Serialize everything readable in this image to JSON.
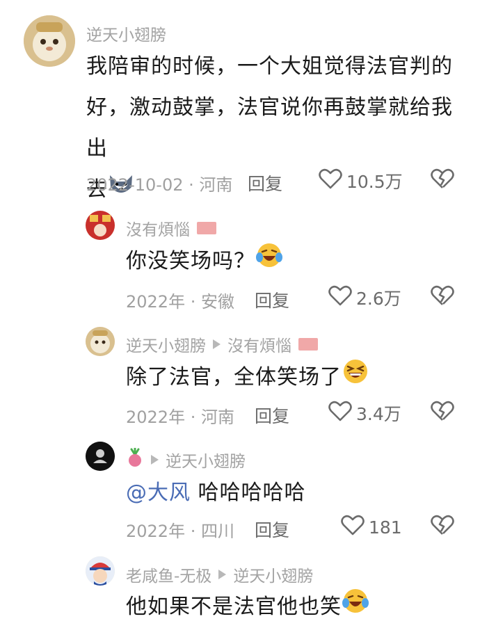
{
  "comments": [
    {
      "user": "逆天小翅膀",
      "text1": "我陪审的时候，一个大姐觉得法官判的",
      "text2": "好，激动鼓掌，法官说你再鼓掌就给我出",
      "text3": "去",
      "date": "2022-10-02",
      "location": "河南",
      "reply": "回复",
      "likes": "10.5万"
    },
    {
      "user": "沒有煩惱",
      "text": "你没笑场吗？",
      "date": "2022年",
      "location": "安徽",
      "reply": "回复",
      "likes": "2.6万"
    },
    {
      "user": "逆天小翅膀",
      "reply_to": "沒有煩惱",
      "text": "除了法官，全体笑场了",
      "date": "2022年",
      "location": "河南",
      "reply": "回复",
      "likes": "3.4万"
    },
    {
      "reply_to": "逆天小翅膀",
      "mention": "@大风",
      "text": " 哈哈哈哈哈",
      "date": "2022年",
      "location": "四川",
      "reply": "回复",
      "likes": "181"
    },
    {
      "user": "老咸鱼-无极",
      "reply_to": "逆天小翅膀",
      "text": "他如果不是法官他也笑"
    }
  ],
  "separator": " · ",
  "colors": {
    "text": "#1a1a1a",
    "meta": "#a0a0a0",
    "mention": "#4a6cb5"
  }
}
